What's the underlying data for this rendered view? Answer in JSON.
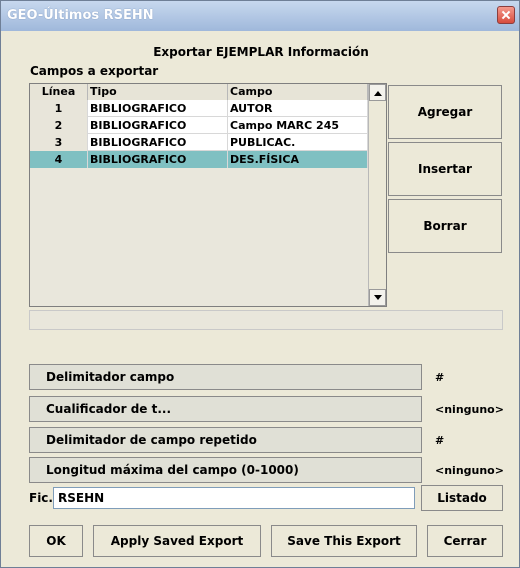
{
  "window": {
    "title": "GEO-Últimos RSEHN"
  },
  "header": {
    "title": "Exportar EJEMPLAR Información"
  },
  "fields": {
    "label": "Campos a exportar",
    "columns": {
      "linea": "Línea",
      "tipo": "Tipo",
      "campo": "Campo"
    },
    "rows": [
      {
        "linea": "1",
        "tipo": "BIBLIOGRAFICO",
        "campo": "AUTOR"
      },
      {
        "linea": "2",
        "tipo": "BIBLIOGRAFICO",
        "campo": "Campo MARC 245"
      },
      {
        "linea": "3",
        "tipo": "BIBLIOGRAFICO",
        "campo": "PUBLICAC."
      },
      {
        "linea": "4",
        "tipo": "BIBLIOGRAFICO",
        "campo": "DES.FÍSICA"
      }
    ],
    "selected_row": 4
  },
  "actions": {
    "agregar": "Agregar",
    "insertar": "Insertar",
    "borrar": "Borrar"
  },
  "options": [
    {
      "label": "Delimitador campo",
      "value": "#"
    },
    {
      "label": "Cualificador de t...",
      "value": "<ninguno>"
    },
    {
      "label": "Delimitador de campo repetido",
      "value": "#"
    },
    {
      "label": "Longitud máxima del campo (0-1000)",
      "value": "<ninguno>"
    }
  ],
  "file": {
    "label": "Fic...",
    "value": "RSEHN",
    "listado": "Listado"
  },
  "footer": {
    "ok": "OK",
    "apply_saved_export": "Apply Saved Export",
    "save_this_export": "Save This Export",
    "cerrar": "Cerrar"
  }
}
